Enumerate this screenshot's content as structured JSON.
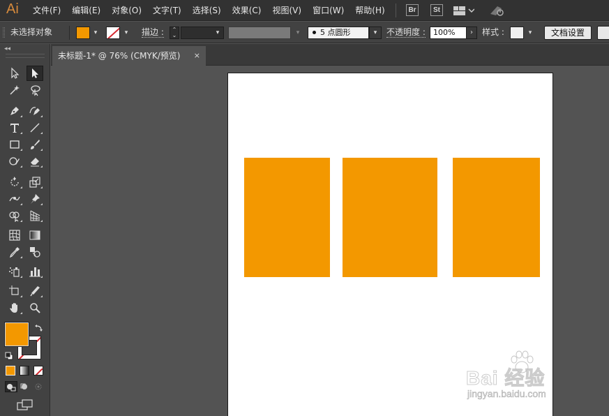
{
  "app": {
    "logo": "Ai"
  },
  "menu": [
    "文件(F)",
    "编辑(E)",
    "对象(O)",
    "文字(T)",
    "选择(S)",
    "效果(C)",
    "视图(V)",
    "窗口(W)",
    "帮助(H)"
  ],
  "menubar_right": {
    "bridge_label": "Br",
    "stock_label": "St"
  },
  "control_bar": {
    "selection_status": "未选择对象",
    "stroke_label": "描边 :",
    "brush_value": "5 点圆形",
    "opacity_label": "不透明度 :",
    "opacity_value": "100%",
    "style_label": "样式 :",
    "doc_setup_button": "文档设置"
  },
  "document_tab": {
    "title": "未标题-1* @ 76% (CMYK/预览)",
    "close": "×"
  },
  "colors": {
    "fill": "#f39800",
    "stroke": "#ffffff",
    "none_slash": "#d4282f",
    "artboard": "#ffffff"
  },
  "artboard": {
    "objects": [
      "rectangle",
      "rectangle",
      "rectangle"
    ]
  },
  "watermark": {
    "text": "Bai 经验",
    "url": "jingyan.baidu.com"
  }
}
